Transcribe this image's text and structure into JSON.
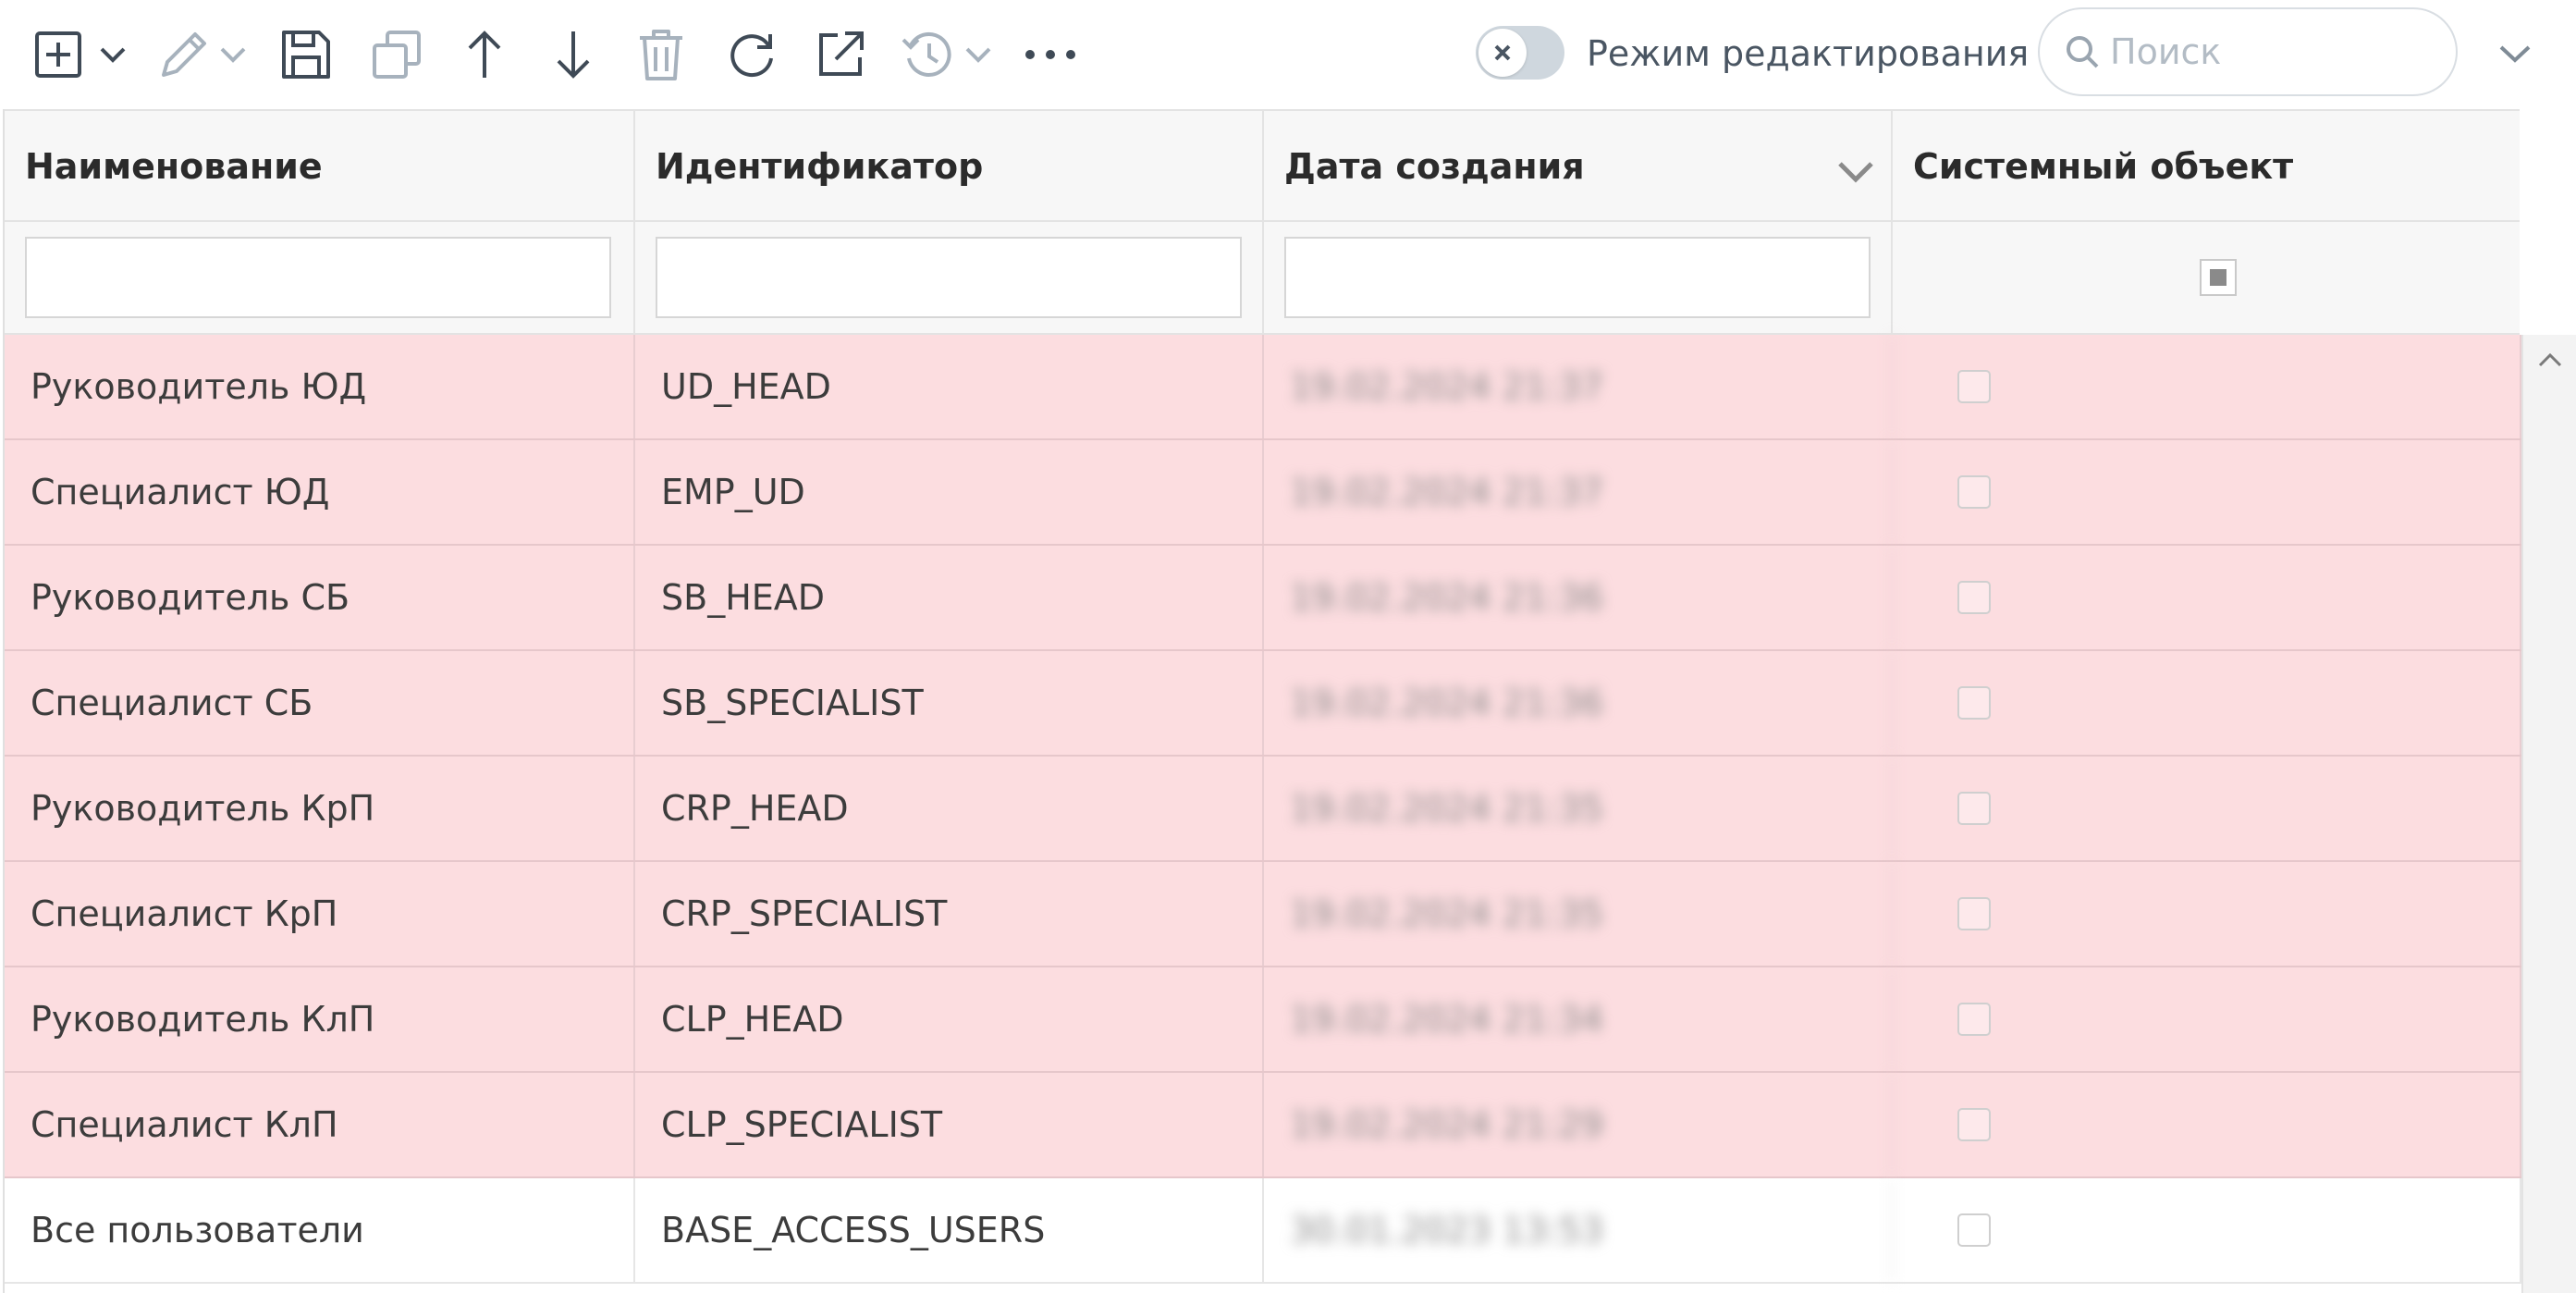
{
  "toolbar": {
    "icons": [
      "add-icon",
      "chevron-down-icon",
      "edit-icon",
      "chevron-down-icon",
      "save-icon",
      "copy-icon",
      "arrow-up-icon",
      "arrow-down-icon",
      "trash-icon",
      "refresh-icon",
      "external-link-icon",
      "history-icon",
      "chevron-down-icon",
      "more-icon"
    ],
    "edit_mode_label": "Режим редактирования",
    "search_placeholder": "Поиск"
  },
  "table": {
    "columns": [
      "Наименование",
      "Идентификатор",
      "Дата создания",
      "Системный объект"
    ],
    "rows": [
      {
        "name": "Руководитель ЮД",
        "id": "UD_HEAD",
        "date": "19.02.2024 21:37",
        "highlight": true
      },
      {
        "name": "Специалист ЮД",
        "id": "EMP_UD",
        "date": "19.02.2024 21:37",
        "highlight": true
      },
      {
        "name": "Руководитель СБ",
        "id": "SB_HEAD",
        "date": "19.02.2024 21:36",
        "highlight": true
      },
      {
        "name": "Специалист СБ",
        "id": "SB_SPECIALIST",
        "date": "19.02.2024 21:36",
        "highlight": true
      },
      {
        "name": "Руководитель КрП",
        "id": "CRP_HEAD",
        "date": "19.02.2024 21:35",
        "highlight": true
      },
      {
        "name": "Специалист КрП",
        "id": "CRP_SPECIALIST",
        "date": "19.02.2024 21:35",
        "highlight": true
      },
      {
        "name": "Руководитель КлП",
        "id": "CLP_HEAD",
        "date": "19.02.2024 21:34",
        "highlight": true
      },
      {
        "name": "Специалист КлП",
        "id": "CLP_SPECIALIST",
        "date": "19.02.2024 21:29",
        "highlight": true
      },
      {
        "name": "Все пользователи",
        "id": "BASE_ACCESS_USERS",
        "date": "30.01.2023 13:53",
        "highlight": false
      }
    ]
  },
  "colors": {
    "highlight_row": "#fcdde0",
    "toolbar_icon": "#3f4a56",
    "disabled_icon": "#a7b2bd"
  }
}
